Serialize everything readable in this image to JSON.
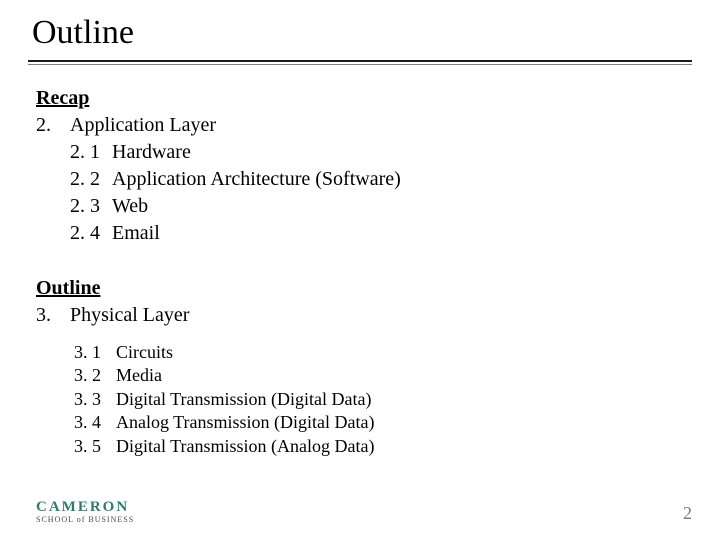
{
  "title": "Outline",
  "recap": {
    "heading": "Recap",
    "item": {
      "num": "2.",
      "label": "Application Layer"
    },
    "sub": [
      {
        "num": "2. 1",
        "label": "Hardware"
      },
      {
        "num": "2. 2",
        "label": "Application Architecture (Software)"
      },
      {
        "num": "2. 3",
        "label": "Web"
      },
      {
        "num": "2. 4",
        "label": "Email"
      }
    ]
  },
  "outline": {
    "heading": "Outline",
    "item": {
      "num": "3.",
      "label": "Physical Layer"
    },
    "sub": [
      {
        "num": "3. 1",
        "label": "Circuits"
      },
      {
        "num": "3. 2",
        "label": "Media"
      },
      {
        "num": "3. 3",
        "label": "Digital Transmission (Digital Data)"
      },
      {
        "num": "3. 4",
        "label": "Analog Transmission (Digital Data)"
      },
      {
        "num": "3. 5",
        "label": "Digital Transmission (Analog Data)"
      }
    ]
  },
  "footer": {
    "logo_line1": "CAMERON",
    "logo_line2": "SCHOOL of BUSINESS",
    "page": "2"
  }
}
